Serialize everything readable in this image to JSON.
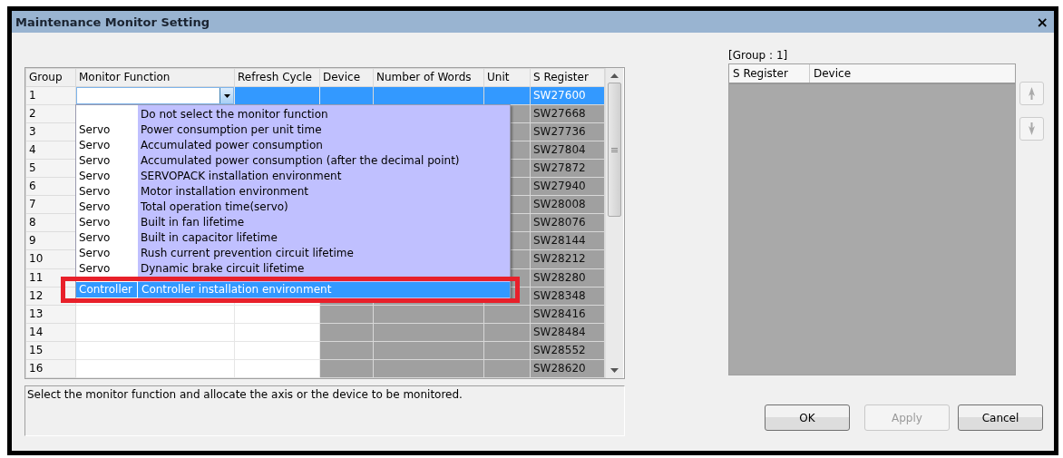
{
  "window": {
    "title": "Maintenance Monitor Setting",
    "close": "×"
  },
  "grid": {
    "columns": [
      "Group",
      "Monitor Function",
      "Refresh Cycle",
      "Device",
      "Number of Words",
      "Unit",
      "S Register"
    ],
    "rows": [
      {
        "group": "1",
        "s_register": "SW27600",
        "selected": true
      },
      {
        "group": "2",
        "s_register": "SW27668",
        "selected": false
      },
      {
        "group": "3",
        "s_register": "SW27736",
        "selected": false
      },
      {
        "group": "4",
        "s_register": "SW27804",
        "selected": false
      },
      {
        "group": "5",
        "s_register": "SW27872",
        "selected": false
      },
      {
        "group": "6",
        "s_register": "SW27940",
        "selected": false
      },
      {
        "group": "7",
        "s_register": "SW28008",
        "selected": false
      },
      {
        "group": "8",
        "s_register": "SW28076",
        "selected": false
      },
      {
        "group": "9",
        "s_register": "SW28144",
        "selected": false
      },
      {
        "group": "10",
        "s_register": "SW28212",
        "selected": false
      },
      {
        "group": "11",
        "s_register": "SW28280",
        "selected": false
      },
      {
        "group": "12",
        "s_register": "SW28348",
        "selected": false
      },
      {
        "group": "13",
        "s_register": "SW28416",
        "selected": false
      },
      {
        "group": "14",
        "s_register": "SW28484",
        "selected": false
      },
      {
        "group": "15",
        "s_register": "SW28552",
        "selected": false
      },
      {
        "group": "16",
        "s_register": "SW28620",
        "selected": false
      }
    ]
  },
  "dropdown": {
    "items": [
      {
        "function": "Do not select the monitor function",
        "selected": false
      },
      {
        "category": "Servo",
        "function": "Power consumption per unit time",
        "selected": false
      },
      {
        "category": "Servo",
        "function": "Accumulated power consumption",
        "selected": false
      },
      {
        "category": "Servo",
        "function": "Accumulated power consumption (after the decimal point)",
        "selected": false
      },
      {
        "category": "Servo",
        "function": "SERVOPACK installation environment",
        "selected": false
      },
      {
        "category": "Servo",
        "function": "Motor installation environment",
        "selected": false
      },
      {
        "category": "Servo",
        "function": "Total operation time(servo)",
        "selected": false
      },
      {
        "category": "Servo",
        "function": "Built in fan lifetime",
        "selected": false
      },
      {
        "category": "Servo",
        "function": "Built in capacitor lifetime",
        "selected": false
      },
      {
        "category": "Servo",
        "function": "Rush current prevention circuit lifetime",
        "selected": false
      },
      {
        "category": "Servo",
        "function": "Dynamic brake circuit lifetime",
        "selected": false
      },
      {
        "category": "Controller",
        "function": "Controller installation environment",
        "selected": true
      }
    ]
  },
  "description": "Select the monitor function and allocate the axis or the device to be monitored.",
  "group_panel": {
    "label": "[Group : 1]",
    "columns": [
      "S Register",
      "Device"
    ]
  },
  "buttons": [
    {
      "label": "OK",
      "disabled": false
    },
    {
      "label": "Apply",
      "disabled": true
    },
    {
      "label": "Cancel",
      "disabled": false
    }
  ]
}
